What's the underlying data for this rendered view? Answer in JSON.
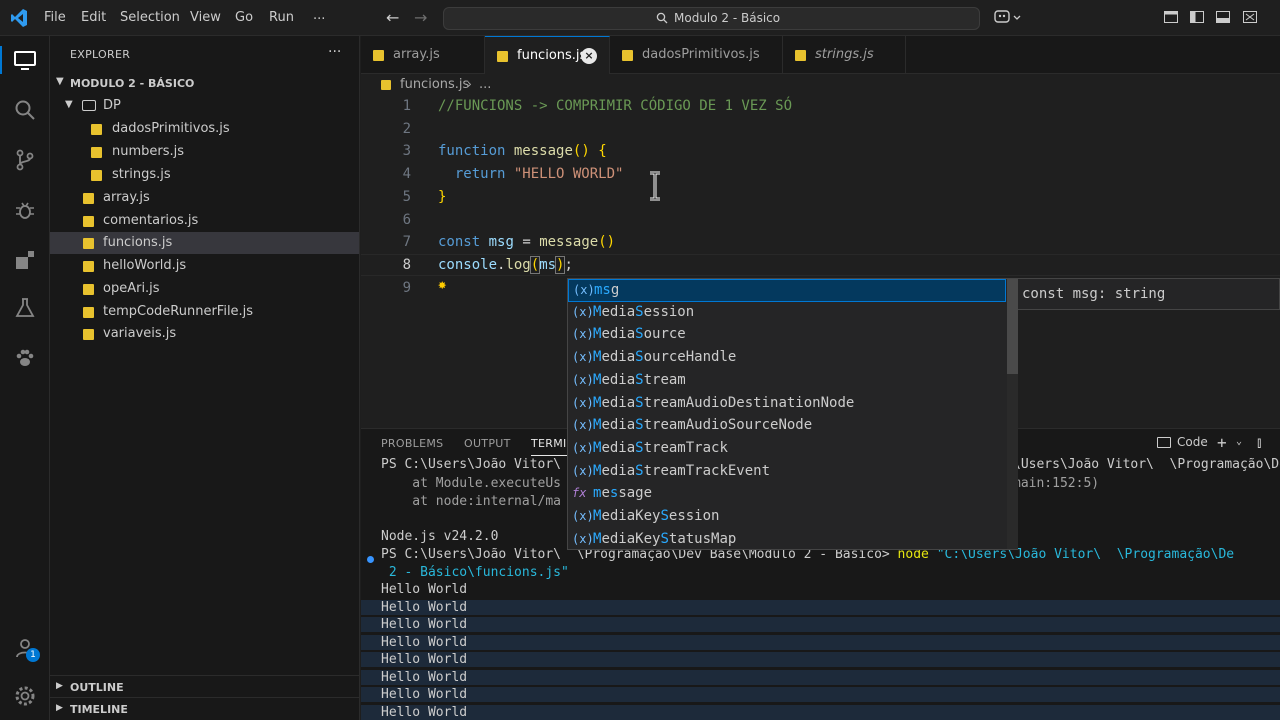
{
  "menu": [
    "File",
    "Edit",
    "Selection",
    "View",
    "Go",
    "Run",
    "..."
  ],
  "command_center": {
    "text": "Modulo 2 - Básico"
  },
  "sidebar": {
    "title": "EXPLORER",
    "more": "···",
    "root": "MODULO 2 - BÁSICO",
    "folder": "DP",
    "folder_files": [
      "dadosPrimitivos.js",
      "numbers.js",
      "strings.js"
    ],
    "files": [
      "array.js",
      "comentarios.js",
      "funcions.js",
      "helloWorld.js",
      "opeAri.js",
      "tempCodeRunnerFile.js",
      "variaveis.js"
    ],
    "selected_file": "funcions.js",
    "outline": "OUTLINE",
    "timeline": "TIMELINE"
  },
  "tabs": [
    {
      "label": "array.js",
      "active": false,
      "italic": false
    },
    {
      "label": "funcions.js",
      "active": true,
      "italic": false
    },
    {
      "label": "dadosPrimitivos.js",
      "active": false,
      "italic": false
    },
    {
      "label": "strings.js",
      "active": false,
      "italic": true
    }
  ],
  "breadcrumb": {
    "file": "funcions.js",
    "sep": "›",
    "more": "..."
  },
  "editor": {
    "line_numbers": [
      "1",
      "2",
      "3",
      "4",
      "5",
      "6",
      "7",
      "8",
      "9"
    ],
    "active_line": "8",
    "code": {
      "l1": "//FUNCIONS -> COMPRIMIR CÓDIGO DE 1 VEZ SÓ",
      "l3_kw": "function",
      "l3_fn": "message",
      "l3_paren": "()",
      "l3_brace": "{",
      "l4_kw": "return",
      "l4_str": "\"HELLO WORLD\"",
      "l5_brace": "}",
      "l7_kw": "const",
      "l7_var": "msg",
      "l7_eq": "=",
      "l7_fn": "message",
      "l7_paren": "()",
      "l8_obj": "console",
      "l8_dot": ".",
      "l8_fn": "log",
      "l8_open": "(",
      "l8_arg": "ms",
      "l8_close": ")",
      "l8_semi": ";"
    }
  },
  "suggest": {
    "items": [
      {
        "icon": "(x)",
        "match": "ms",
        "rest": "g",
        "kind": "variable"
      },
      {
        "icon": "(x)",
        "match": "M",
        "mid": "edia",
        "match2": "S",
        "rest": "ession",
        "kind": "variable"
      },
      {
        "icon": "(x)",
        "match": "M",
        "mid": "edia",
        "match2": "S",
        "rest": "ource",
        "kind": "variable"
      },
      {
        "icon": "(x)",
        "match": "M",
        "mid": "edia",
        "match2": "S",
        "rest": "ourceHandle",
        "kind": "variable"
      },
      {
        "icon": "(x)",
        "match": "M",
        "mid": "edia",
        "match2": "S",
        "rest": "tream",
        "kind": "variable"
      },
      {
        "icon": "(x)",
        "match": "M",
        "mid": "edia",
        "match2": "S",
        "rest": "treamAudioDestinationNode",
        "kind": "variable"
      },
      {
        "icon": "(x)",
        "match": "M",
        "mid": "edia",
        "match2": "S",
        "rest": "treamAudioSourceNode",
        "kind": "variable"
      },
      {
        "icon": "(x)",
        "match": "M",
        "mid": "edia",
        "match2": "S",
        "rest": "treamTrack",
        "kind": "variable"
      },
      {
        "icon": "(x)",
        "match": "M",
        "mid": "edia",
        "match2": "S",
        "rest": "treamTrackEvent",
        "kind": "variable"
      },
      {
        "icon": "fx",
        "match": "m",
        "mid": "e",
        "match2": "s",
        "rest": "sage",
        "kind": "function"
      },
      {
        "icon": "(x)",
        "match": "M",
        "mid": "ediaKey",
        "match2": "S",
        "rest": "ession",
        "kind": "variable"
      },
      {
        "icon": "(x)",
        "match": "M",
        "mid": "ediaKey",
        "match2": "S",
        "rest": "tatusMap",
        "kind": "variable"
      }
    ],
    "detail": "const msg: string"
  },
  "panel": {
    "tabs": [
      "PROBLEMS",
      "OUTPUT",
      "TERMINAL"
    ],
    "active_tab": "TERMINAL",
    "terminal_kind": "Code",
    "add": "+",
    "terminal": {
      "l1_prompt": "PS C:\\Users\\João Vitor\\",
      "l1_right": "\\Users\\João Vitor\\  \\Programação\\De",
      "l2": "    at Module.executeUs",
      "l2_right": "main:152:5)",
      "l3": "    at node:internal/ma",
      "l4": "Node.js v24.2.0",
      "l5_prompt": "PS C:\\Users\\João Vitor\\  \\Programação\\Dev Base\\Modulo 2 - Básico>",
      "l5_cmd": " node",
      "l5_arg": " \"C:\\Users\\João Vitor\\  \\Programação\\De",
      "l6": " 2 - Básico\\funcions.js\"",
      "outputs": [
        "Hello World",
        "Hello World",
        "Hello World",
        "Hello World",
        "Hello World",
        "Hello World",
        "Hello World",
        "Hello World"
      ]
    }
  },
  "activity_badge": "1",
  "colors": {
    "accent": "#0078d4",
    "js": "#e8c22e",
    "match": "#2aaaff"
  }
}
